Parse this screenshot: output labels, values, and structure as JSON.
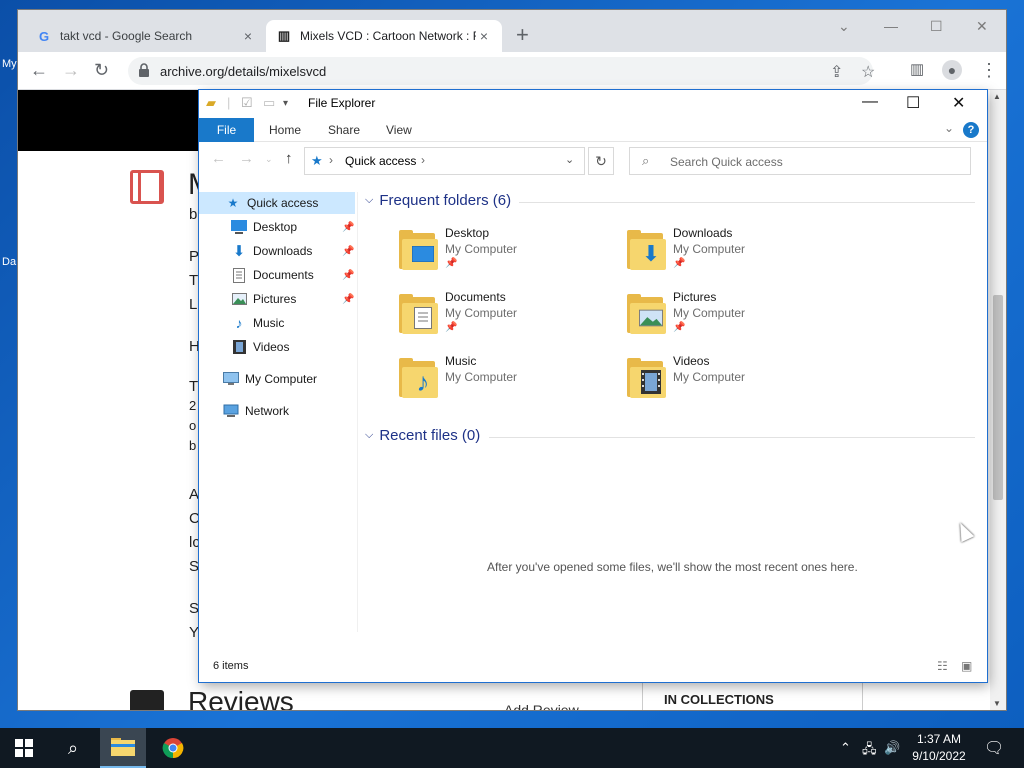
{
  "desktop": {
    "fragments": [
      "My",
      "Da"
    ]
  },
  "browser": {
    "tabs": [
      {
        "title": "takt vcd - Google Search",
        "favicon": "G",
        "close": "×"
      },
      {
        "title": "Mixels VCD : Cartoon Network : F",
        "favicon": "▥",
        "close": "×"
      }
    ],
    "new_tab": "+",
    "url": "archive.org/details/mixelsvcd"
  },
  "page": {
    "left_fragments": [
      "M",
      "b",
      "P",
      "T",
      "L",
      "H",
      "T",
      "2",
      "o",
      "b",
      "A",
      "C",
      "lc",
      "S",
      "S",
      "Y"
    ],
    "reviews": "Reviews",
    "add_review": "Add Review",
    "in_collections": "IN COLLECTIONS"
  },
  "explorer": {
    "title": "File Explorer",
    "ribbon_tabs": [
      "File",
      "Home",
      "Share",
      "View"
    ],
    "address": "Quick access",
    "search_placeholder": "Search Quick access",
    "nav": [
      {
        "label": "Quick access",
        "icon": "star-icon",
        "pinned": false
      },
      {
        "label": "Desktop",
        "icon": "desktop-icon",
        "pinned": true
      },
      {
        "label": "Downloads",
        "icon": "download-icon",
        "pinned": true
      },
      {
        "label": "Documents",
        "icon": "documents-icon",
        "pinned": true
      },
      {
        "label": "Pictures",
        "icon": "pictures-icon",
        "pinned": true
      },
      {
        "label": "Music",
        "icon": "music-icon",
        "pinned": false
      },
      {
        "label": "Videos",
        "icon": "videos-icon",
        "pinned": false
      },
      {
        "label": "My Computer",
        "icon": "computer-icon",
        "pinned": false
      },
      {
        "label": "Network",
        "icon": "network-icon",
        "pinned": false
      }
    ],
    "frequent_header": "Frequent folders (6)",
    "folders": [
      {
        "name": "Desktop",
        "location": "My Computer",
        "pinned": true
      },
      {
        "name": "Downloads",
        "location": "My Computer",
        "pinned": true
      },
      {
        "name": "Documents",
        "location": "My Computer",
        "pinned": true
      },
      {
        "name": "Pictures",
        "location": "My Computer",
        "pinned": true
      },
      {
        "name": "Music",
        "location": "My Computer",
        "pinned": false
      },
      {
        "name": "Videos",
        "location": "My Computer",
        "pinned": false
      }
    ],
    "recent_header": "Recent files (0)",
    "recent_empty": "After you've opened some files, we'll show the most recent ones here.",
    "status": "6 items"
  },
  "taskbar": {
    "time": "1:37 AM",
    "date": "9/10/2022"
  }
}
